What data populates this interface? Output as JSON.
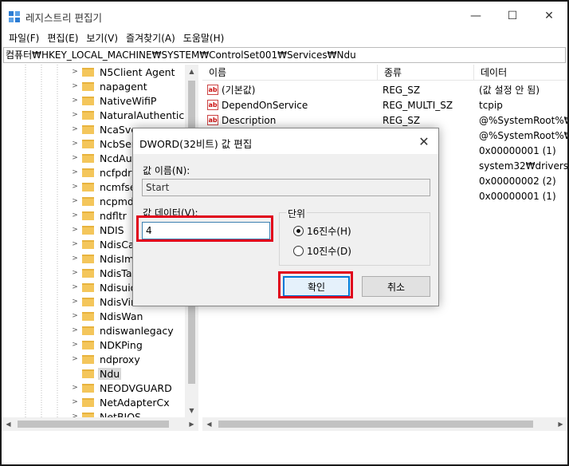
{
  "window": {
    "title": "레지스트리 편집기",
    "min_glyph": "—",
    "max_glyph": "☐",
    "close_glyph": "✕"
  },
  "menu": [
    "파일(F)",
    "편집(E)",
    "보기(V)",
    "즐겨찾기(A)",
    "도움말(H)"
  ],
  "address": "컴퓨터₩HKEY_LOCAL_MACHINE₩SYSTEM₩ControlSet001₩Services₩Ndu",
  "tree": {
    "items": [
      "N5Client Agent",
      "napagent",
      "NativeWifiP",
      "NaturalAuthenticatio",
      "NcaSvc",
      "NcbService",
      "NcdAutoSetup",
      "ncfpdrv",
      "ncmfsecf",
      "ncpmdrv",
      "ndfltr",
      "NDIS",
      "NdisCap",
      "NdisImPlatform",
      "NdisTapi",
      "Ndisuio",
      "NdisVirtualBus",
      "NdisWan",
      "ndiswanlegacy",
      "NDKPing",
      "ndproxy",
      "Ndu",
      "NEODVGUARD",
      "NetAdapterCx",
      "NetBIOS"
    ],
    "selected": "Ndu"
  },
  "list": {
    "columns": [
      "이름",
      "종류",
      "데이터"
    ],
    "rows": [
      {
        "name": "(기본값)",
        "type": "REG_SZ",
        "data": "(값 설정 안 됨)"
      },
      {
        "name": "DependOnService",
        "type": "REG_MULTI_SZ",
        "data": "tcpip"
      },
      {
        "name": "Description",
        "type": "REG_SZ",
        "data": "@%SystemRoot%₩sy"
      },
      {
        "name": "",
        "type": "",
        "data": "@%SystemRoot%₩sy"
      },
      {
        "name": "",
        "type": "",
        "data": "0x00000001 (1)"
      },
      {
        "name": "",
        "type": "D_SZ",
        "data": "system32₩drivers₩N"
      },
      {
        "name": "",
        "type": "",
        "data": "0x00000002 (2)"
      },
      {
        "name": "",
        "type": "",
        "data": "0x00000001 (1)"
      }
    ],
    "icon_text": "ab"
  },
  "dialog": {
    "title": "DWORD(32비트) 값 편집",
    "value_name_label": "값 이름(N):",
    "value_name": "Start",
    "value_data_label": "값 데이터(V):",
    "value_data": "4",
    "base_label": "단위",
    "base_hex": "16진수(H)",
    "base_dec": "10진수(D)",
    "base_selected": "hex",
    "ok": "확인",
    "cancel": "취소",
    "close_glyph": "✕"
  },
  "colors": {
    "highlight": "#e0001b",
    "folder": "#f4c65b",
    "accent": "#0078d7"
  }
}
